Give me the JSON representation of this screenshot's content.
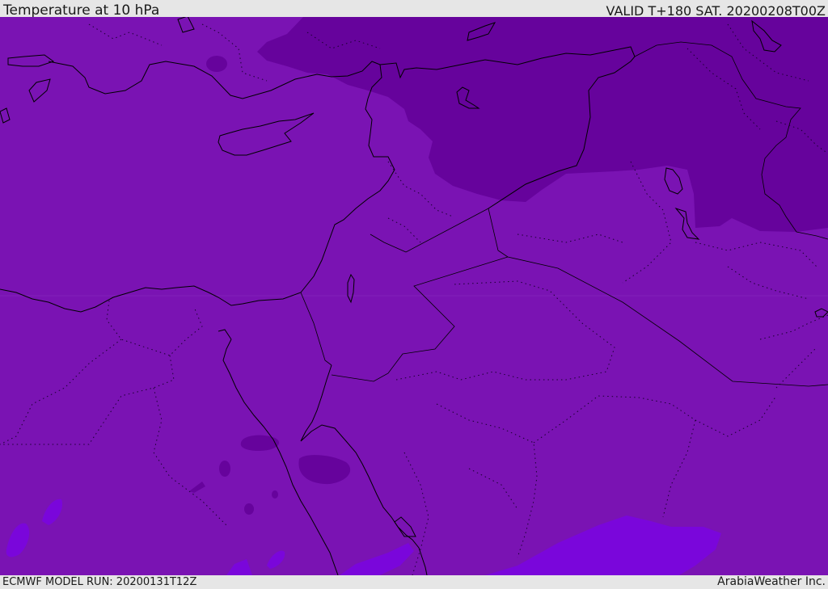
{
  "header": {
    "title": "Temperature at 10 hPa",
    "valid": "VALID T+180 SAT. 20200208T00Z"
  },
  "footer": {
    "model_run": "ECMWF MODEL RUN: 20200131T12Z",
    "credit": "ArabiaWeather Inc."
  },
  "colors": {
    "base_fill": "#7a13b3",
    "cold_fill": "#66039c",
    "warm_fill": "#7a06db",
    "coastline": "#000000",
    "header_bg": "#e6e6e6"
  }
}
